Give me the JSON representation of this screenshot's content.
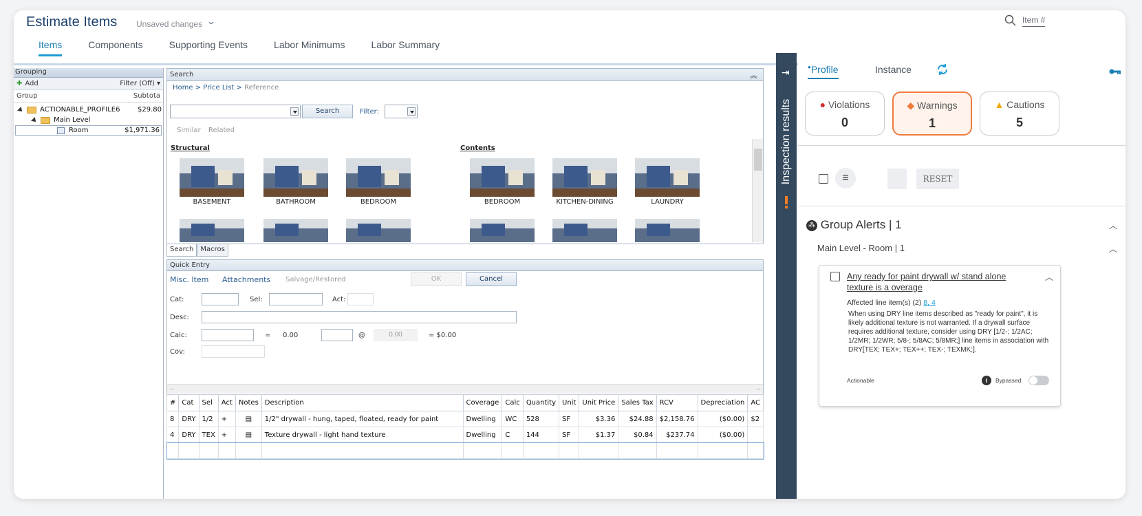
{
  "header": {
    "title": "Estimate Items",
    "unsaved": "Unsaved changes",
    "search_label": "Item #",
    "tabs": [
      "Items",
      "Components",
      "Supporting Events",
      "Labor Minimums",
      "Labor Summary"
    ]
  },
  "grouping": {
    "title": "Grouping",
    "add": "Add",
    "filter": "Filter (Off)",
    "col_group": "Group",
    "col_subtotal": "Subtota",
    "rows": [
      {
        "name": "ACTIONABLE_PROFILE6",
        "value": "$29.80"
      },
      {
        "name": "Main Level",
        "value": ""
      },
      {
        "name": "Room",
        "value": "$1,971.36"
      }
    ]
  },
  "search": {
    "title": "Search",
    "crumb_home": "Home",
    "crumb_price": "Price List",
    "crumb_ref": "Reference",
    "search_btn": "Search",
    "filter_label": "Filter:",
    "similar": "Similar",
    "related": "Related",
    "structural": "Structural",
    "contents": "Contents",
    "structural_items": [
      "BASEMENT",
      "BATHROOM",
      "BEDROOM"
    ],
    "contents_items": [
      "BEDROOM",
      "KITCHEN-DINING",
      "LAUNDRY"
    ],
    "bottom_tabs": [
      "Search",
      "Macros"
    ]
  },
  "quick_entry": {
    "title": "Quick Entry",
    "misc": "Misc. Item",
    "attachments": "Attachments",
    "salvage": "Salvage/Restored",
    "ok": "OK",
    "cancel": "Cancel",
    "cat": "Cat:",
    "sel": "Sel:",
    "act": "Act:",
    "desc": "Desc:",
    "calc": "Calc:",
    "cov": "Cov:",
    "eq": "=",
    "val1": "0.00",
    "at": "@",
    "val2": "0.00",
    "total": "= $0.00"
  },
  "line_items": {
    "columns": [
      "#",
      "Cat",
      "Sel",
      "Act",
      "Notes",
      "Description",
      "Coverage",
      "Calc",
      "Quantity",
      "Unit",
      "Unit Price",
      "Sales Tax",
      "RCV",
      "Depreciation",
      "AC"
    ],
    "rows": [
      [
        "8",
        "DRY",
        "1/2",
        "+",
        "",
        "1/2\" drywall - hung, taped, floated, ready for paint",
        "Dwelling",
        "WC",
        "528",
        "SF",
        "$3.36",
        "$24.88",
        "$2,158.76",
        "($0.00)",
        "$2"
      ],
      [
        "4",
        "DRY",
        "TEX",
        "+",
        "",
        "Texture drywall - light hand texture",
        "Dwelling",
        "C",
        "144",
        "SF",
        "$1.37",
        "$0.84",
        "$237.74",
        "($0.00)",
        ""
      ]
    ]
  },
  "inspection": {
    "sidebar_label": "Inspection results",
    "tab_profile": "Profile",
    "tab_instance": "Instance",
    "violations_label": "Violations",
    "violations_count": "0",
    "warnings_label": "Warnings",
    "warnings_count": "1",
    "cautions_label": "Cautions",
    "cautions_count": "5",
    "reset": "RESET",
    "group_alerts": "Group Alerts | 1",
    "sub_group": "Main Level  -  Room | 1",
    "alert_title": "Any ready for paint drywall w/ stand alone texture is a overage",
    "affected": "Affected line item(s) (2)",
    "affected_links": "8, 4",
    "alert_body": "When using DRY line items described as \"ready for paint\", it is likely additional texture is not warranted. If a drywall surface requires additional texture, consider using DRY [1/2-; 1/2AC; 1/2MR; 1/2WR; 5/8-; 5/8AC; 5/8MR;] line items in association with DRY[TEX; TEX+; TEX++; TEX-; TEXMK;].",
    "actionable": "Actionable",
    "bypassed": "Bypassed"
  },
  "colors": {
    "accent": "#1c7fb2",
    "warning": "#f07b3f",
    "violation": "#d32f2f",
    "caution": "#f2a900",
    "sidebar": "#34495e"
  }
}
